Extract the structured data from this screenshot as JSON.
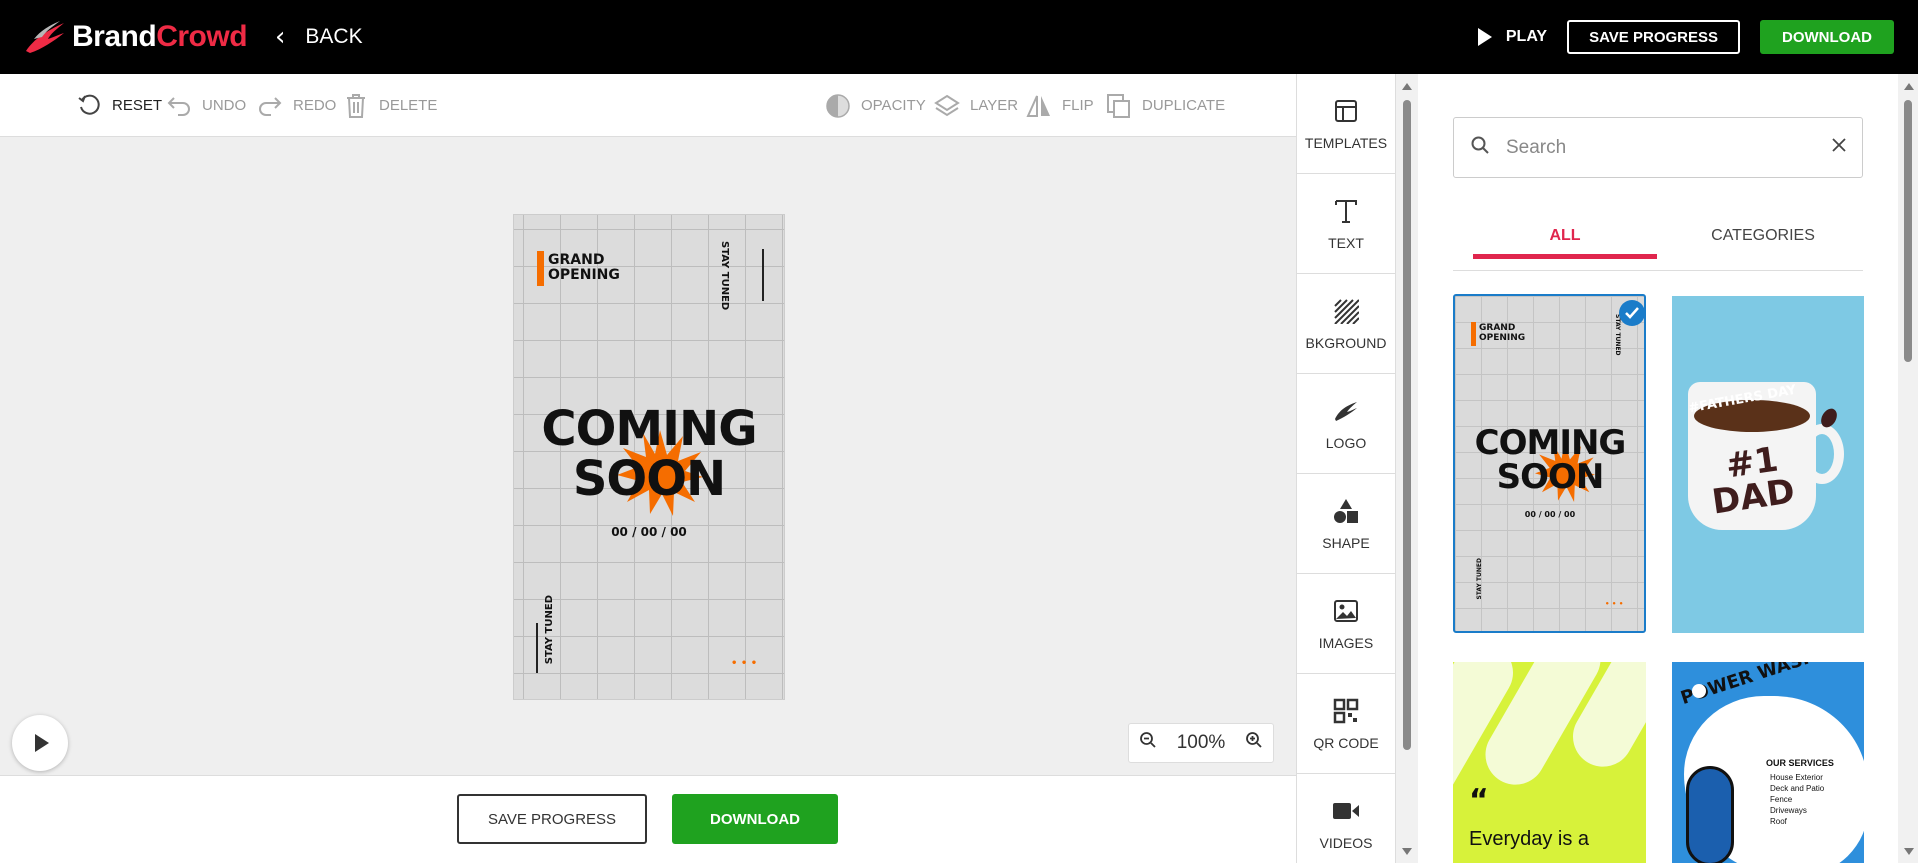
{
  "brand": {
    "name_part1": "Brand",
    "name_part2": "Crowd"
  },
  "header": {
    "back_label": "BACK",
    "play_label": "PLAY",
    "save_label": "SAVE PROGRESS",
    "download_label": "DOWNLOAD"
  },
  "toolbar": {
    "reset": "RESET",
    "undo": "UNDO",
    "redo": "REDO",
    "delete": "DELETE",
    "opacity": "OPACITY",
    "layer": "LAYER",
    "flip": "FLIP",
    "duplicate": "DUPLICATE"
  },
  "poster": {
    "grand": "GRAND",
    "opening": "OPENING",
    "stay_tuned_top": "STAY TUNED",
    "coming": "COMING",
    "soon": "SOON",
    "date": "00 / 00 / 00",
    "stay_tuned_bottom": "STAY TUNED",
    "dots": "• • •"
  },
  "zoom": {
    "level": "100%"
  },
  "bottom": {
    "save_label": "SAVE PROGRESS",
    "download_label": "DOWNLOAD"
  },
  "sidenav": [
    {
      "label": "TEMPLATES",
      "icon": "templates-icon"
    },
    {
      "label": "TEXT",
      "icon": "text-icon"
    },
    {
      "label": "BKGROUND",
      "icon": "background-icon"
    },
    {
      "label": "LOGO",
      "icon": "logo-icon"
    },
    {
      "label": "SHAPE",
      "icon": "shape-icon"
    },
    {
      "label": "IMAGES",
      "icon": "images-icon"
    },
    {
      "label": "QR CODE",
      "icon": "qr-code-icon"
    },
    {
      "label": "VIDEOS",
      "icon": "videos-icon"
    }
  ],
  "panel": {
    "search_placeholder": "Search",
    "tabs": [
      {
        "label": "ALL"
      },
      {
        "label": "CATEGORIES"
      }
    ],
    "templates": {
      "t1": {
        "grand": "GRAND",
        "opening": "OPENING",
        "stay": "STAY TUNED",
        "coming": "COMING",
        "soon": "SOON",
        "date": "00 / 00 / 00",
        "stay2": "STAY TUNED",
        "dots": "• • •"
      },
      "t2": {
        "tag": "#FATHERS DAY",
        "line1": "#1",
        "line2": "DAD"
      },
      "t3": {
        "quote": "Everyday is a"
      },
      "t4": {
        "title": "POWER WASHING",
        "services_title": "OUR SERVICES",
        "services": [
          "House Exterior",
          "Deck and Patio",
          "Fence",
          "Driveways",
          "Roof"
        ]
      }
    }
  },
  "colors": {
    "brand_red": "#ef2b45",
    "accent_green": "#1fa21f",
    "tab_active": "#e0264d",
    "poster_orange": "#f56d00"
  }
}
